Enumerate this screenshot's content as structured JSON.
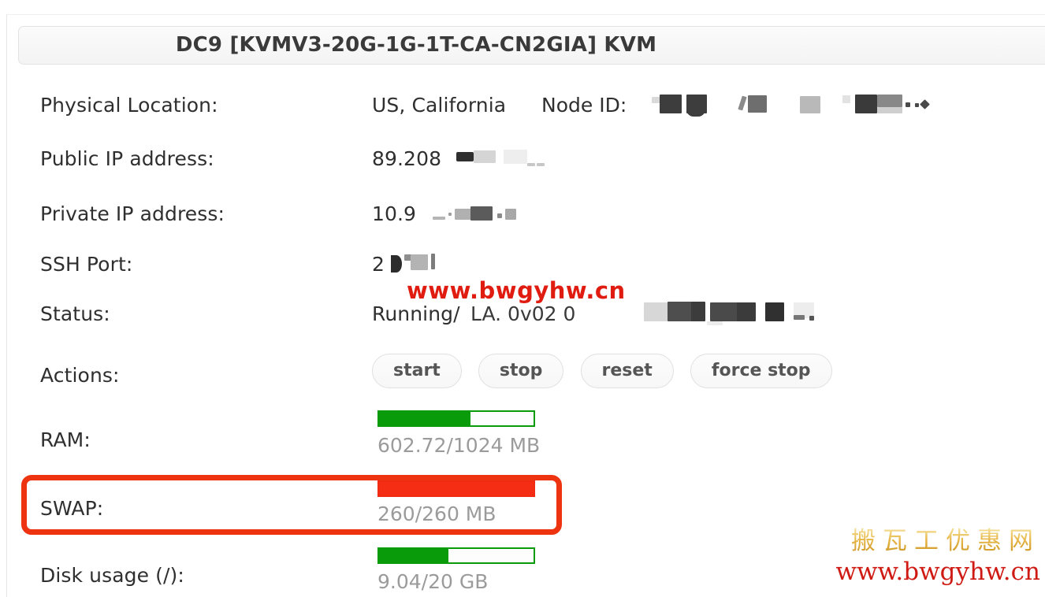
{
  "header": {
    "title": "DC9   [KVMV3-20G-1G-1T-CA-CN2GIA]   KVM"
  },
  "details": {
    "rows": [
      {
        "label": "Physical Location:",
        "value": "US, California"
      },
      {
        "label": "Public IP address:",
        "value": "89.208"
      },
      {
        "label": "Private IP address:",
        "value": "10.9"
      },
      {
        "label": "SSH Port:",
        "value": "2"
      },
      {
        "label": "Status:",
        "value": "Running/"
      }
    ],
    "node_id_label": "Node ID:",
    "status_extra": "LA. 0v02 0"
  },
  "actions": {
    "label": "Actions:",
    "buttons": [
      {
        "label": "start"
      },
      {
        "label": "stop"
      },
      {
        "label": "reset"
      },
      {
        "label": "force stop"
      }
    ]
  },
  "meters": [
    {
      "label": "RAM:",
      "text": "602.72/1024 MB",
      "used": 602.72,
      "total": 1024,
      "unit": "MB",
      "percent": 59,
      "color": "#0a9b0a",
      "state": "normal"
    },
    {
      "label": "SWAP:",
      "text": "260/260 MB",
      "used": 260,
      "total": 260,
      "unit": "MB",
      "percent": 100,
      "color": "#f42d14",
      "state": "full"
    },
    {
      "label": "Disk usage (/):",
      "text": "9.04/20 GB",
      "used": 9.04,
      "total": 20,
      "unit": "GB",
      "percent": 45,
      "color": "#0a9b0a",
      "state": "normal"
    }
  ],
  "annotation": {
    "target": "SWAP:",
    "color": "#ee3311"
  },
  "watermarks": {
    "status_overlay": "www.bwgyhw.cn",
    "corner_cn": "搬瓦工优惠网",
    "corner_url": "www.bwgyhw.cn",
    "corner_cn_color": "#d9a62f",
    "corner_url_color": "#cf1a13"
  }
}
